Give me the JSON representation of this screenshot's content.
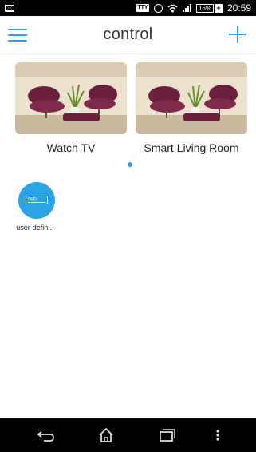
{
  "status_bar": {
    "tty_label": "TTY",
    "battery_label": "16%",
    "time": "20:59",
    "icons": [
      "mail-icon",
      "tty-icon",
      "alarm-icon",
      "wifi-icon",
      "signal-icon",
      "battery-icon"
    ]
  },
  "header": {
    "title": "control",
    "menu_icon": "hamburger-menu-icon",
    "add_icon": "plus-icon",
    "accent_color": "#2f9de8"
  },
  "scenes": [
    {
      "label": "Watch TV",
      "image": "living-room-photo"
    },
    {
      "label": "Smart Living Room",
      "image": "living-room-photo"
    }
  ],
  "pager": {
    "active_page": 1,
    "total_pages": 1
  },
  "devices": [
    {
      "label": "user-defin...",
      "icon": "dvd-player-icon",
      "screen_text": "DVD",
      "color": "#29a3e3"
    }
  ],
  "nav_bar": {
    "icons": [
      "back-icon",
      "home-icon",
      "recent-apps-icon",
      "more-icon"
    ]
  }
}
